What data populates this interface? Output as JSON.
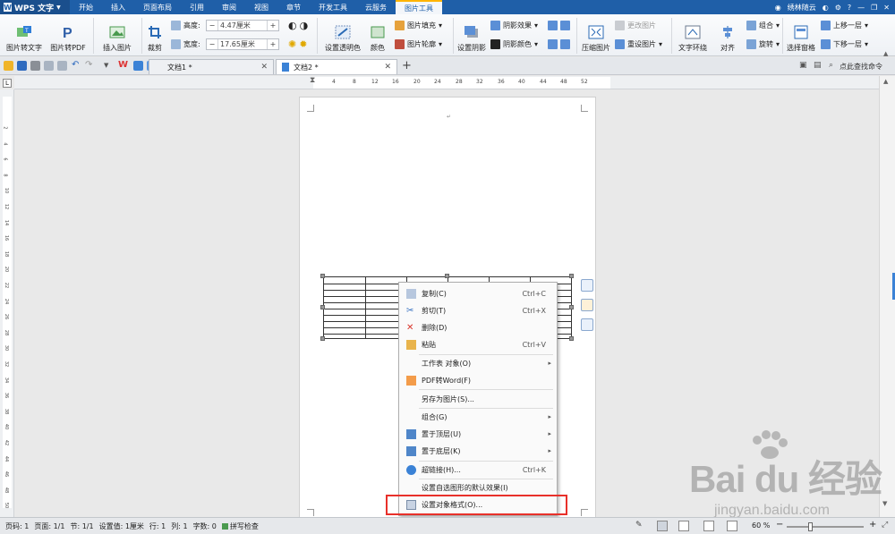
{
  "menubar": {
    "app": "WPS 文字",
    "tabs": [
      "开始",
      "插入",
      "页面布局",
      "引用",
      "审阅",
      "视图",
      "章节",
      "开发工具",
      "云服务",
      "图片工具"
    ],
    "active_tab": "图片工具",
    "user": "绣林随云"
  },
  "ribbon": {
    "pic_to_text": "图片转文字",
    "pic_to_pdf": "图片转PDF",
    "insert_pic": "插入图片",
    "crop": "裁剪",
    "height_label": "高度:",
    "height_value": "4.47厘米",
    "width_label": "宽度:",
    "width_value": "17.65厘米",
    "set_transparent": "设置透明色",
    "color": "颜色",
    "pic_fill": "图片填充",
    "pic_outline": "图片轮廓",
    "set_shadow": "设置阴影",
    "shadow_effect": "阴影效果",
    "shadow_color": "阴影颜色",
    "compress": "压缩图片",
    "change_pic": "更改图片",
    "reset_pic": "重设图片",
    "text_wrap": "文字环绕",
    "align": "对齐",
    "group": "组合",
    "rotate": "旋转",
    "select_pane": "选择窗格",
    "bring_forward": "上移一层",
    "send_backward": "下移一层"
  },
  "tabs": {
    "doc1": "文档1 *",
    "doc2": "文档2 *",
    "search": "点此查找命令"
  },
  "ruler": {
    "ticks": [
      "4",
      "8",
      "12",
      "16",
      "20",
      "24",
      "28",
      "32",
      "36",
      "40",
      "44",
      "48",
      "52"
    ],
    "vticks": [
      "2",
      "4",
      "6",
      "8",
      "10",
      "12",
      "14",
      "16",
      "18",
      "20",
      "22",
      "24",
      "26",
      "28",
      "30",
      "32",
      "34",
      "36",
      "38",
      "40",
      "42",
      "44",
      "46",
      "48",
      "50"
    ]
  },
  "context_menu": {
    "items": [
      {
        "label": "复制(C)",
        "shortcut": "Ctrl+C"
      },
      {
        "label": "剪切(T)",
        "shortcut": "Ctrl+X"
      },
      {
        "label": "删除(D)",
        "shortcut": ""
      },
      {
        "label": "粘贴",
        "shortcut": "Ctrl+V"
      },
      {
        "label": "工作表 对象(O)",
        "shortcut": ""
      },
      {
        "label": "PDF转Word(F)",
        "shortcut": ""
      },
      {
        "label": "另存为图片(S)...",
        "shortcut": ""
      },
      {
        "label": "组合(G)",
        "shortcut": ""
      },
      {
        "label": "置于顶层(U)",
        "shortcut": ""
      },
      {
        "label": "置于底层(K)",
        "shortcut": ""
      },
      {
        "label": "超链接(H)...",
        "shortcut": "Ctrl+K"
      },
      {
        "label": "设置自选图形的默认效果(I)",
        "shortcut": ""
      },
      {
        "label": "设置对象格式(O)...",
        "shortcut": ""
      }
    ]
  },
  "status": {
    "page_num": "页码: 1",
    "pages": "页面: 1/1",
    "section": "节: 1/1",
    "setting": "设置值: 1厘米",
    "row": "行: 1",
    "col": "列: 1",
    "chars": "字数: 0",
    "spell": "拼写检查",
    "zoom": "60 %"
  },
  "watermark": {
    "brand": "Bai du 经验",
    "url": "jingyan.baidu.com"
  },
  "colors": {
    "menubar": "#1f5fa8",
    "highlight": "#e8302a"
  }
}
